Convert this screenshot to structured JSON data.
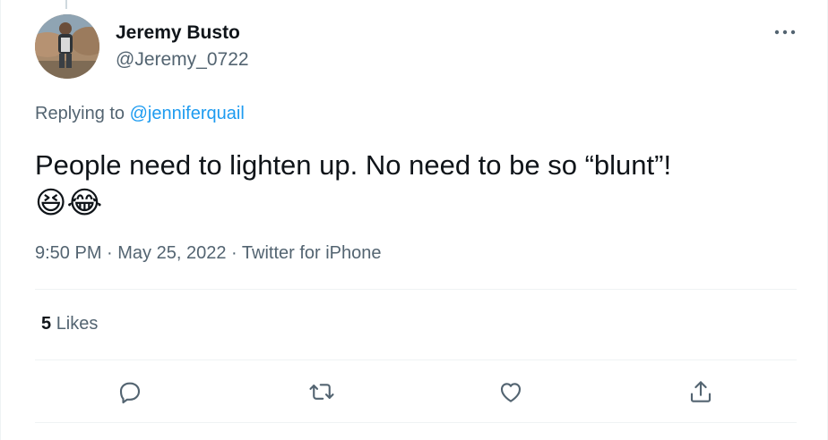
{
  "author": {
    "name": "Jeremy Busto",
    "handle": "@Jeremy_0722"
  },
  "reply": {
    "prefix": "Replying to",
    "mention": "@jenniferquail"
  },
  "tweet": {
    "text": "People need to lighten up. No need to be so “blunt”!",
    "emojis": [
      "😆",
      "😂"
    ]
  },
  "meta": {
    "time": "9:50 PM",
    "separator1": " · ",
    "date": "May 25, 2022",
    "separator2": " · ",
    "source": "Twitter for iPhone"
  },
  "stats": {
    "likes_count": "5",
    "likes_label": "Likes"
  },
  "icons": {
    "more": "more-horizontal-icon",
    "reply": "reply-icon",
    "retweet": "retweet-icon",
    "like": "like-icon",
    "share": "share-icon"
  },
  "colors": {
    "text": "#0f1419",
    "secondary": "#536471",
    "link": "#1d9bf0",
    "divider": "#eff3f4"
  }
}
